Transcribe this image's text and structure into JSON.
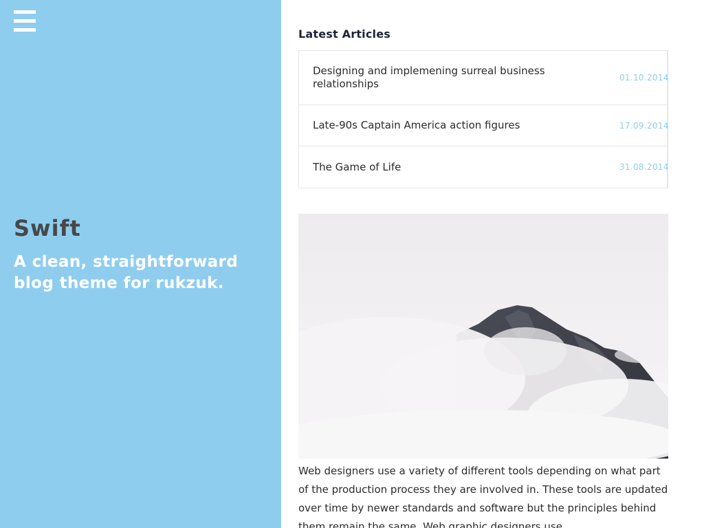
{
  "sidebar": {
    "background_color": "#8fcdee",
    "menu_icon": "hamburger-menu-icon",
    "site_title": "Swift",
    "tagline": "A clean, straightforward blog theme for rukzuk."
  },
  "main": {
    "section_heading": "Latest Articles",
    "articles": [
      {
        "title": "Designing and implemening surreal business relationships",
        "date": "01.10.2014"
      },
      {
        "title": "Late-90s Captain America action figures",
        "date": "17.09.2014"
      },
      {
        "title": "The Game of Life",
        "date": "31.08.2014"
      }
    ],
    "hero_image": "misty-mountain-peak-photo",
    "body_text": "Web designers use a variety of different tools depending on what part of the production process they are involved in. These tools are updated over time by newer standards and software but the principles behind them remain the same. Web graphic designers use"
  },
  "colors": {
    "accent": "#8fcdee",
    "title_dark": "#46484a",
    "text": "#2b2b2b"
  }
}
